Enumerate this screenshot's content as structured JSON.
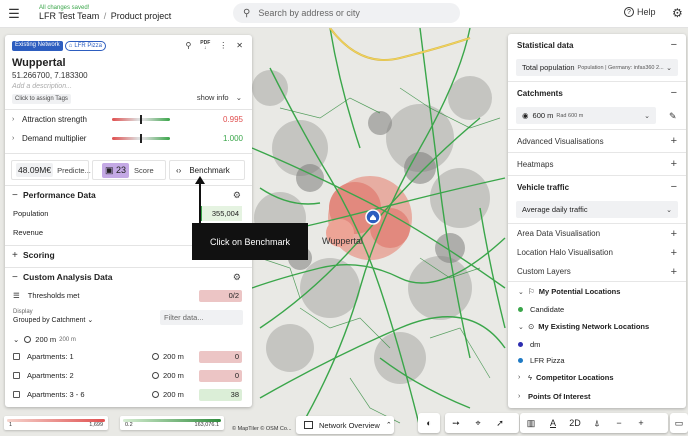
{
  "header": {
    "saved_status": "All changes saved!",
    "team": "LFR Test Team",
    "separator": "/",
    "project": "Product project",
    "search_placeholder": "Search by address or city",
    "help_label": "Help"
  },
  "location": {
    "chip_network": "Existing Network",
    "chip_brand": "LFR Pizza",
    "pdf_label": "PDF",
    "name": "Wuppertal",
    "coords": "51.266700, 7.183300",
    "description_placeholder": "Add a description...",
    "tags_button": "Click to assign Tags",
    "show_info": "show info"
  },
  "sliders": [
    {
      "label": "Attraction strength",
      "value": "0.995",
      "color": "#e04f4f",
      "level": 0.5
    },
    {
      "label": "Demand multiplier",
      "value": "1.000",
      "color": "#3aa64a",
      "level": 0.5
    }
  ],
  "stats": {
    "predicted_value": "48.09M€",
    "predicted_label": "Predicte...",
    "score_value": "23",
    "score_label": "Score",
    "benchmark_label": "Benchmark"
  },
  "performance": {
    "title": "Performance Data",
    "rows": [
      {
        "label": "Population",
        "value": "355,004"
      },
      {
        "label": "Revenue",
        "value": ""
      }
    ]
  },
  "scoring": {
    "title": "Scoring"
  },
  "custom": {
    "title": "Custom Analysis Data",
    "thresholds_label": "Thresholds met",
    "thresholds_value": "0/2",
    "display_label": "Display",
    "display_value": "Grouped by Catchment",
    "filter_placeholder": "Filter data...",
    "group_label": "200 m",
    "group_sub": "200 m",
    "rows": [
      {
        "label": "Apartments: 1",
        "distance": "200 m",
        "value": "0",
        "tone": "red"
      },
      {
        "label": "Apartments: 2",
        "distance": "200 m",
        "value": "0",
        "tone": "red"
      },
      {
        "label": "Apartments: 3 - 6",
        "distance": "200 m",
        "value": "38",
        "tone": "green"
      }
    ]
  },
  "tooltip": {
    "text": "Click on Benchmark"
  },
  "map": {
    "city_label": "Wuppertal",
    "primary_color": "#3aa64a",
    "heat_color": "#e06a5c",
    "pin_color": "#2d5dbf"
  },
  "right_panel": {
    "statistical_title": "Statistical data",
    "total_population": "Total population",
    "total_population_sub": "Population | Germany: infas360 2...",
    "catchments_title": "Catchments",
    "catchment_value": "600 m",
    "catchment_sub": "Rad 600 m",
    "advanced": "Advanced Visualisations",
    "heatmaps": "Heatmaps",
    "vehicle_title": "Vehicle traffic",
    "vehicle_value": "Average daily traffic",
    "area_data": "Area Data Visualisation",
    "location_halo": "Location Halo Visualisation",
    "custom_layers": "Custom Layers",
    "potential_title": "My Potential Locations",
    "potential_items": [
      {
        "label": "Candidate",
        "color": "#3aa64a"
      }
    ],
    "existing_title": "My Existing Network Locations",
    "existing_items": [
      {
        "label": "dm",
        "color": "#2d2db0"
      },
      {
        "label": "LFR Pizza",
        "color": "#1f7ac4"
      }
    ],
    "competitor_title": "Competitor Locations",
    "poi_title": "Points Of Interest"
  },
  "legend": {
    "bar1_min": "1",
    "bar1_max": "1,699",
    "bar2_min": "0.2",
    "bar2_max": "163,076.1"
  },
  "attribution": "© MapTiler  © OSM Co...",
  "bottom": {
    "network_overview": "Network Overview",
    "view_2d": "2D"
  }
}
